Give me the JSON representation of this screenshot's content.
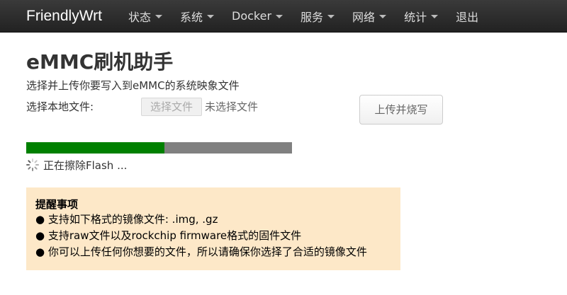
{
  "navbar": {
    "brand": "FriendlyWrt",
    "items": [
      {
        "label": "状态",
        "has_caret": true
      },
      {
        "label": "系统",
        "has_caret": true
      },
      {
        "label": "Docker",
        "has_caret": true
      },
      {
        "label": "服务",
        "has_caret": true
      },
      {
        "label": "网络",
        "has_caret": true
      },
      {
        "label": "统计",
        "has_caret": true
      },
      {
        "label": "退出",
        "has_caret": false
      }
    ]
  },
  "page": {
    "title": "eMMC刷机助手",
    "subtitle": "选择并上传你要写入到eMMC的系统映象文件"
  },
  "form": {
    "file_label": "选择本地文件:",
    "choose_button": "选择文件",
    "file_status": "未选择文件",
    "upload_button": "上传并烧写"
  },
  "progress": {
    "fraction": 0.52,
    "fill_color": "#008000",
    "track_color": "#808080",
    "status_text": "正在擦除Flash ..."
  },
  "notice": {
    "title": "提醒事项",
    "items": [
      "● 支持如下格式的镜像文件: .img, .gz",
      "● 支持raw文件以及rockchip firmware格式的固件文件",
      "● 你可以上传任何你想要的文件，所以请确保你选择了合适的镜像文件"
    ],
    "background": "#fde8c8"
  }
}
